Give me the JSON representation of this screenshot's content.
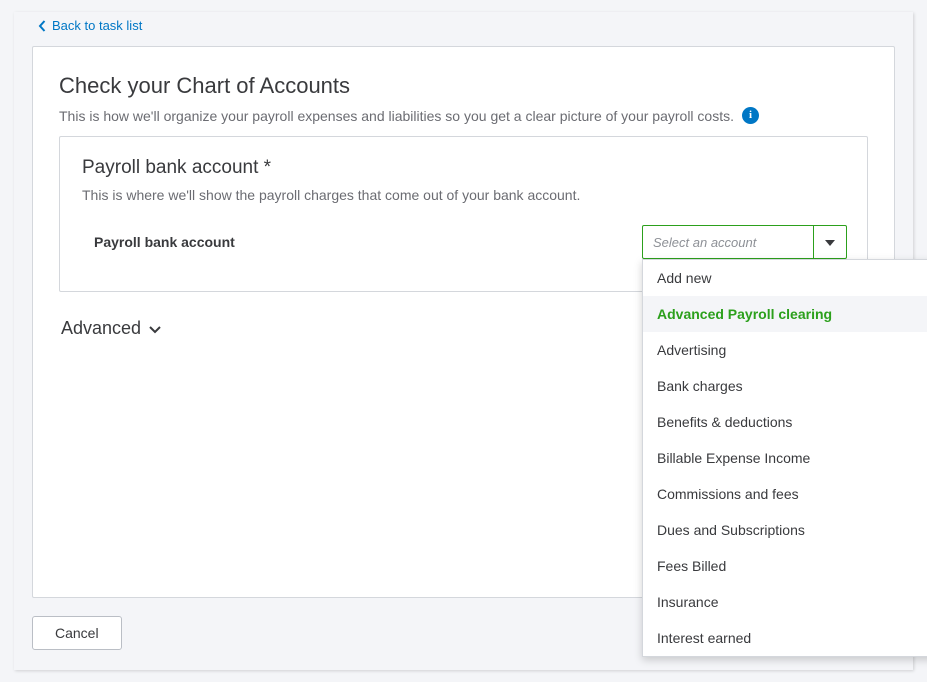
{
  "back_link": {
    "label": "Back to task list"
  },
  "page": {
    "title": "Check your Chart of Accounts",
    "subtitle": "This is how we'll organize your payroll expenses and liabilities so you get a clear picture of your payroll costs."
  },
  "section": {
    "title": "Payroll bank account *",
    "desc": "This is where we'll show the payroll charges that come out of your bank account.",
    "field_label": "Payroll bank account",
    "select_placeholder": "Select an account"
  },
  "dropdown": {
    "options": [
      {
        "label": "Add new",
        "selected": false
      },
      {
        "label": "Advanced Payroll clearing",
        "selected": true
      },
      {
        "label": "Advertising",
        "selected": false
      },
      {
        "label": "Bank charges",
        "selected": false
      },
      {
        "label": "Benefits & deductions",
        "selected": false
      },
      {
        "label": "Billable Expense Income",
        "selected": false
      },
      {
        "label": "Commissions and fees",
        "selected": false
      },
      {
        "label": "Dues and Subscriptions",
        "selected": false
      },
      {
        "label": "Fees Billed",
        "selected": false
      },
      {
        "label": "Insurance",
        "selected": false
      },
      {
        "label": "Interest earned",
        "selected": false
      }
    ]
  },
  "advanced": {
    "label": "Advanced"
  },
  "buttons": {
    "cancel": "Cancel"
  },
  "colors": {
    "accent_green": "#2ca01c",
    "link_blue": "#0077c5"
  }
}
